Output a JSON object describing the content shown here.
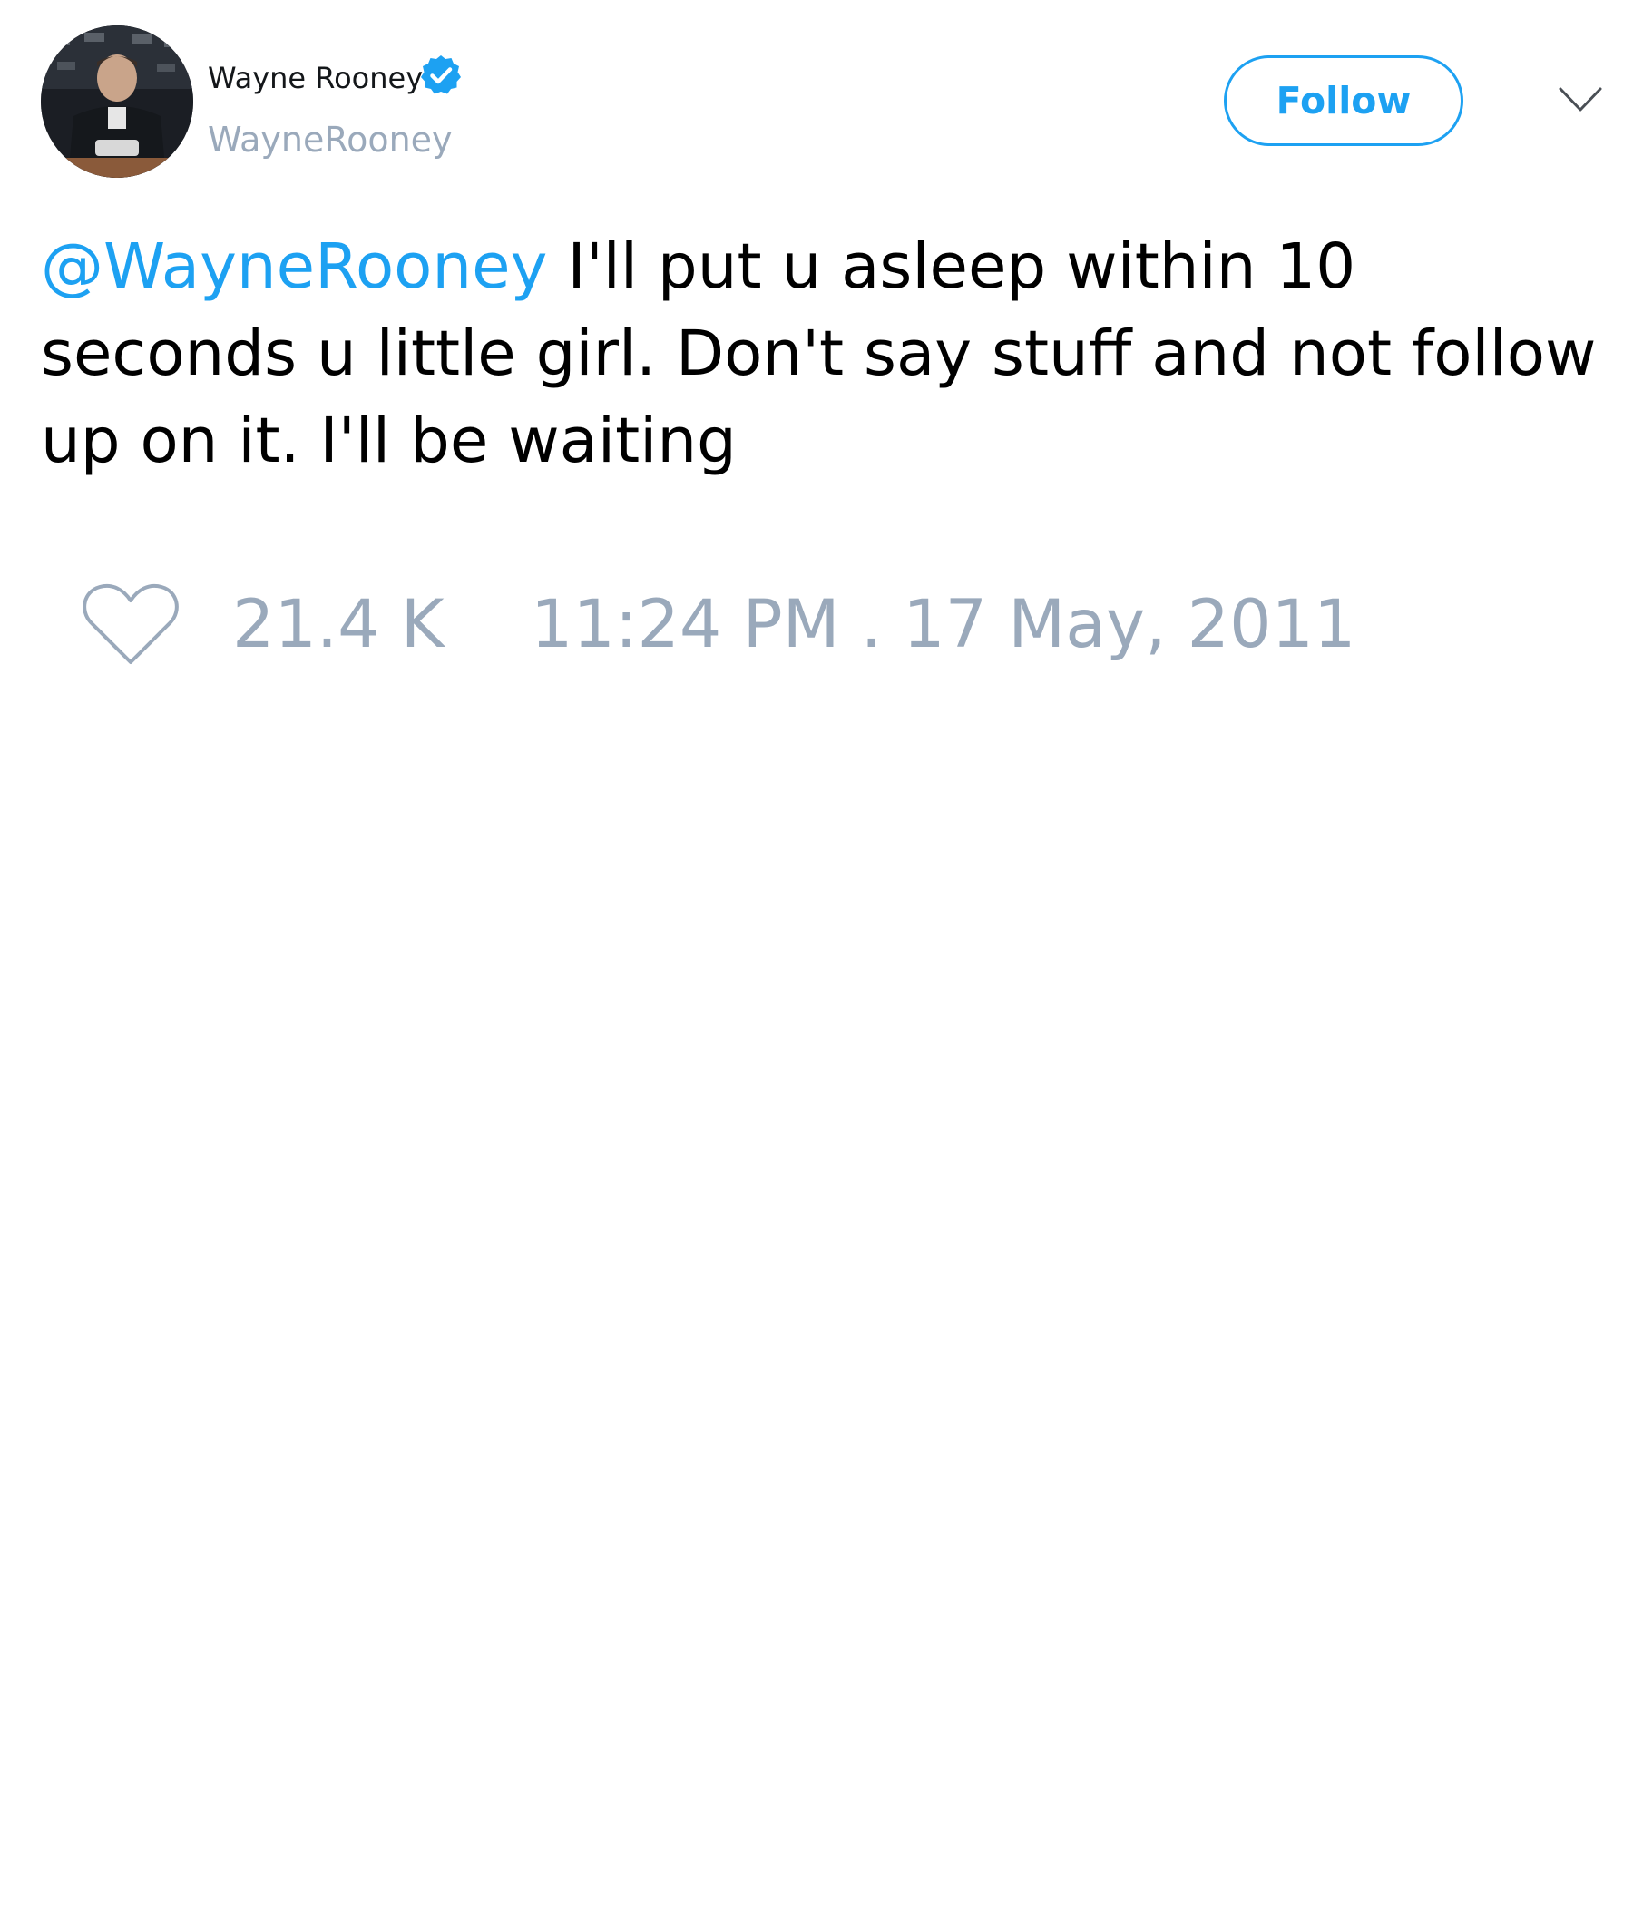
{
  "author": {
    "display_name": "Wayne Rooney",
    "handle": "WayneRooney",
    "verified": true,
    "avatar_icon": "profile-photo"
  },
  "actions": {
    "follow_label": "Follow",
    "menu_icon": "chevron-down-icon"
  },
  "tweet": {
    "mention": "@WayneRooney",
    "text": " I'll put u asleep within 10 seconds u little girl. Don't say stuff and not follow up on it. I'll be waiting"
  },
  "stats": {
    "like_icon": "heart-icon",
    "likes": "21.4 K",
    "timestamp": "11:24 PM . 17 May, 2011"
  },
  "colors": {
    "accent": "#1da1f2",
    "muted": "#9aa9bb",
    "text": "#000000"
  }
}
